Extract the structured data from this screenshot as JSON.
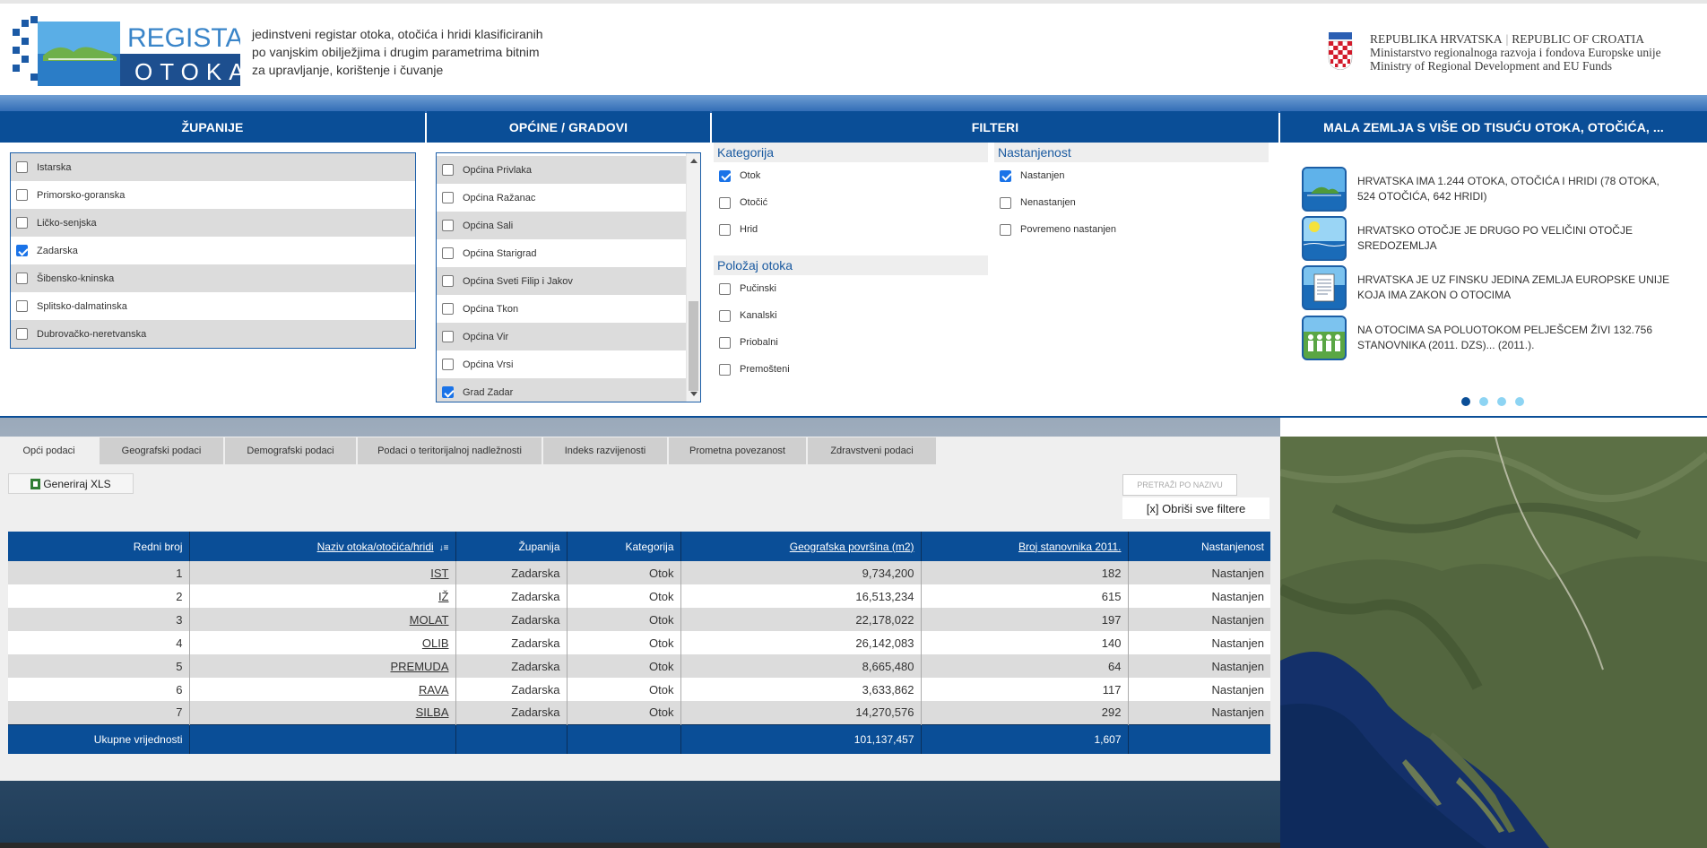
{
  "header": {
    "logo_line1": "REGISTAR",
    "logo_line2": "OTOKA",
    "tagline": [
      "jedinstveni registar otoka, otočića i hridi klasificiranih",
      "po vanjskim obilježjima i drugim parametrima bitnim",
      "za upravljanje, korištenje i čuvanje"
    ],
    "gov_line1a": "REPUBLIKA HRVATSKA",
    "gov_line1b": "REPUBLIC OF CROATIA",
    "gov_line2": "Ministarstvo regionalnoga razvoja i fondova Europske unije",
    "gov_line3": "Ministry of Regional Development and EU Funds"
  },
  "sections": {
    "zupanije": "ŽUPANIJE",
    "opcine": "OPĆINE / GRADOVI",
    "filteri": "FILTERI",
    "mala_zemlja": "MALA ZEMLJA S VIŠE OD TISUĆU OTOKA, OTOČIĆA, ..."
  },
  "zupanije": [
    {
      "label": "Istarska",
      "checked": false
    },
    {
      "label": "Primorsko-goranska",
      "checked": false
    },
    {
      "label": "Ličko-senjska",
      "checked": false
    },
    {
      "label": "Zadarska",
      "checked": true
    },
    {
      "label": "Šibensko-kninska",
      "checked": false
    },
    {
      "label": "Splitsko-dalmatinska",
      "checked": false
    },
    {
      "label": "Dubrovačko-neretvanska",
      "checked": false
    }
  ],
  "opcine": [
    {
      "label": "Općina Privlaka",
      "checked": false
    },
    {
      "label": "Općina Ražanac",
      "checked": false
    },
    {
      "label": "Općina Sali",
      "checked": false
    },
    {
      "label": "Općina Starigrad",
      "checked": false
    },
    {
      "label": "Općina Sveti Filip i Jakov",
      "checked": false
    },
    {
      "label": "Općina Tkon",
      "checked": false
    },
    {
      "label": "Općina Vir",
      "checked": false
    },
    {
      "label": "Općina Vrsi",
      "checked": false
    },
    {
      "label": "Grad Zadar",
      "checked": true
    }
  ],
  "filters": {
    "kategorija": {
      "title": "Kategorija",
      "items": [
        {
          "label": "Otok",
          "checked": true
        },
        {
          "label": "Otočić",
          "checked": false
        },
        {
          "label": "Hrid",
          "checked": false
        }
      ]
    },
    "polozaj": {
      "title": "Položaj otoka",
      "items": [
        {
          "label": "Pučinski",
          "checked": false
        },
        {
          "label": "Kanalski",
          "checked": false
        },
        {
          "label": "Priobalni",
          "checked": false
        },
        {
          "label": "Premošteni",
          "checked": false
        }
      ]
    },
    "nastanjenost": {
      "title": "Nastanjenost",
      "items": [
        {
          "label": "Nastanjen",
          "checked": true
        },
        {
          "label": "Nenastanjen",
          "checked": false
        },
        {
          "label": "Povremeno nastanjen",
          "checked": false
        }
      ]
    }
  },
  "facts": [
    {
      "text": "HRVATSKA IMA 1.244 OTOKA, OTOČIĆA I HRIDI (78 OTOKA, 524 OTOČIĆA, 642 HRIDI)",
      "icon": "island-icon"
    },
    {
      "text": "HRVATSKO OTOČJE JE DRUGO PO VELIČINI OTOČJE SREDOZEMLJA",
      "icon": "sun-sea-icon"
    },
    {
      "text": "HRVATSKA JE UZ FINSKU JEDINA ZEMLJA EUROPSKE UNIJE KOJA IMA ZAKON O OTOCIMA",
      "icon": "document-icon"
    },
    {
      "text": "NA OTOCIMA SA POLUOTOKOM PELJEŠCEM ŽIVI 132.756 STANOVNIKA (2011. DZS)... (2011.).",
      "icon": "people-icon"
    }
  ],
  "carousel_dots": 4,
  "tabs": [
    "Opći podaci",
    "Geografski podaci",
    "Demografski podaci",
    "Podaci o teritorijalnoj nadležnosti",
    "Indeks razvijenosti",
    "Prometna povezanost",
    "Zdravstveni podaci"
  ],
  "toolbar": {
    "xls_label": "Generiraj XLS",
    "search_placeholder": "PRETRAŽI PO NAZIVU",
    "clear_label": "[x] Obriši sve filtere"
  },
  "table": {
    "headers": [
      "Redni broj",
      "Naziv otoka/otočića/hridi",
      "Županija",
      "Kategorija",
      "Geografska površina (m2)",
      "Broj stanovnika 2011.",
      "Nastanjenost"
    ],
    "rows": [
      [
        "1",
        "IST",
        "Zadarska",
        "Otok",
        "9,734,200",
        "182",
        "Nastanjen"
      ],
      [
        "2",
        "IŽ",
        "Zadarska",
        "Otok",
        "16,513,234",
        "615",
        "Nastanjen"
      ],
      [
        "3",
        "MOLAT",
        "Zadarska",
        "Otok",
        "22,178,022",
        "197",
        "Nastanjen"
      ],
      [
        "4",
        "OLIB",
        "Zadarska",
        "Otok",
        "26,142,083",
        "140",
        "Nastanjen"
      ],
      [
        "5",
        "PREMUDA",
        "Zadarska",
        "Otok",
        "8,665,480",
        "64",
        "Nastanjen"
      ],
      [
        "6",
        "RAVA",
        "Zadarska",
        "Otok",
        "3,633,862",
        "117",
        "Nastanjen"
      ],
      [
        "7",
        "SILBA",
        "Zadarska",
        "Otok",
        "14,270,576",
        "292",
        "Nastanjen"
      ]
    ],
    "footer": {
      "label": "Ukupne vrijednosti",
      "area": "101,137,457",
      "population": "1,607"
    }
  },
  "colors": {
    "primary": "#0a4e97",
    "accent": "#1a73e8",
    "dot_inactive": "#8dd4f3"
  }
}
